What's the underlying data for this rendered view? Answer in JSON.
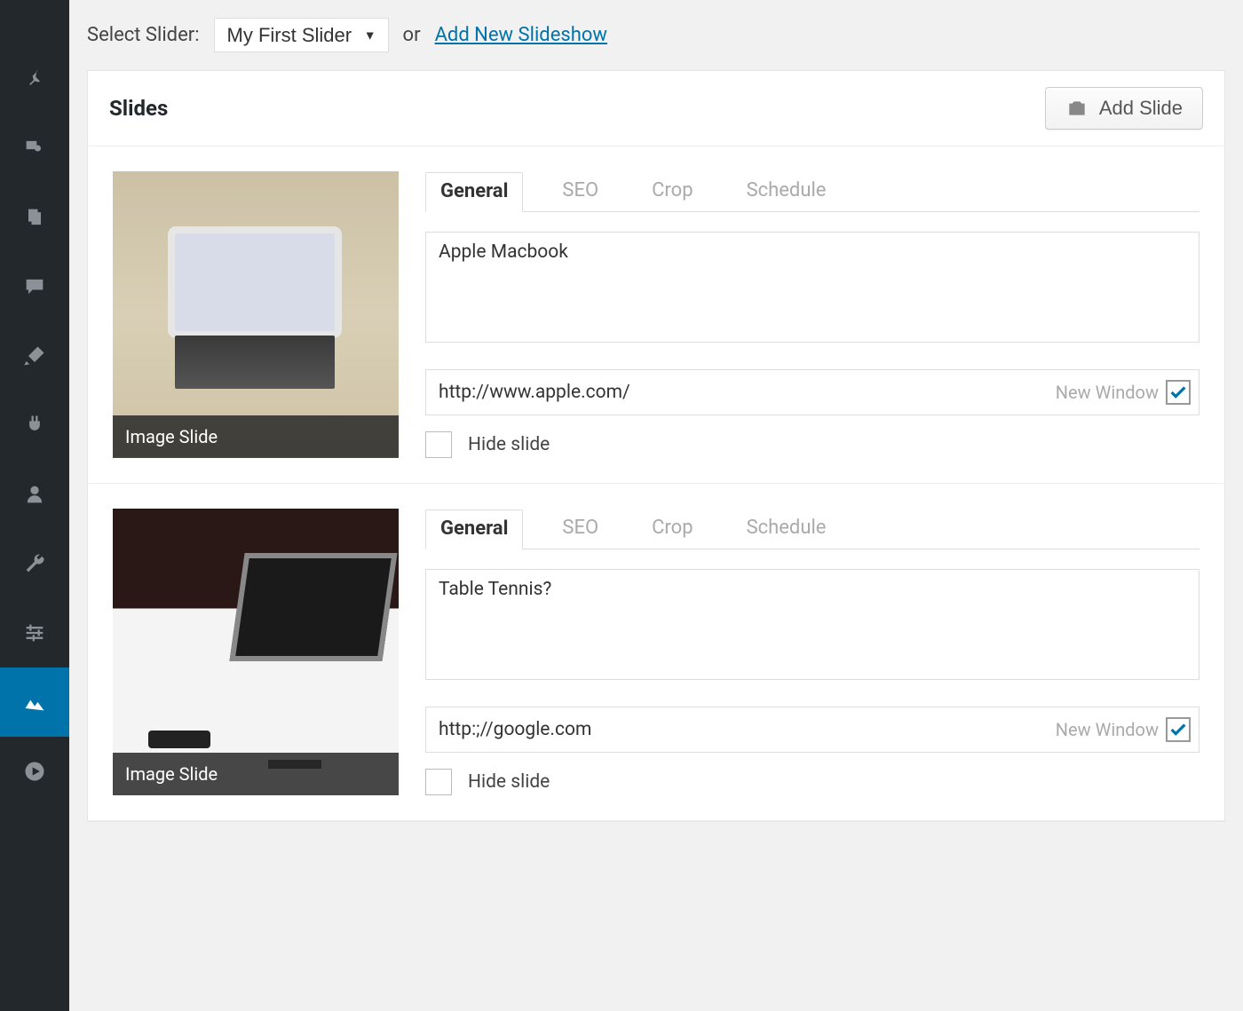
{
  "top": {
    "select_label": "Select Slider:",
    "selected_slider": "My First Slider",
    "or_text": "or",
    "add_new_link": "Add New Slideshow"
  },
  "panel": {
    "title": "Slides",
    "add_slide_label": "Add Slide"
  },
  "tabs": [
    "General",
    "SEO",
    "Crop",
    "Schedule"
  ],
  "common": {
    "new_window_label": "New Window",
    "hide_slide_label": "Hide slide",
    "thumb_caption": "Image Slide"
  },
  "slides": [
    {
      "caption": "Apple Macbook",
      "url": "http://www.apple.com/",
      "new_window": true,
      "hide": false
    },
    {
      "caption": "Table Tennis?",
      "url": "http:;//google.com",
      "new_window": true,
      "hide": false
    }
  ]
}
